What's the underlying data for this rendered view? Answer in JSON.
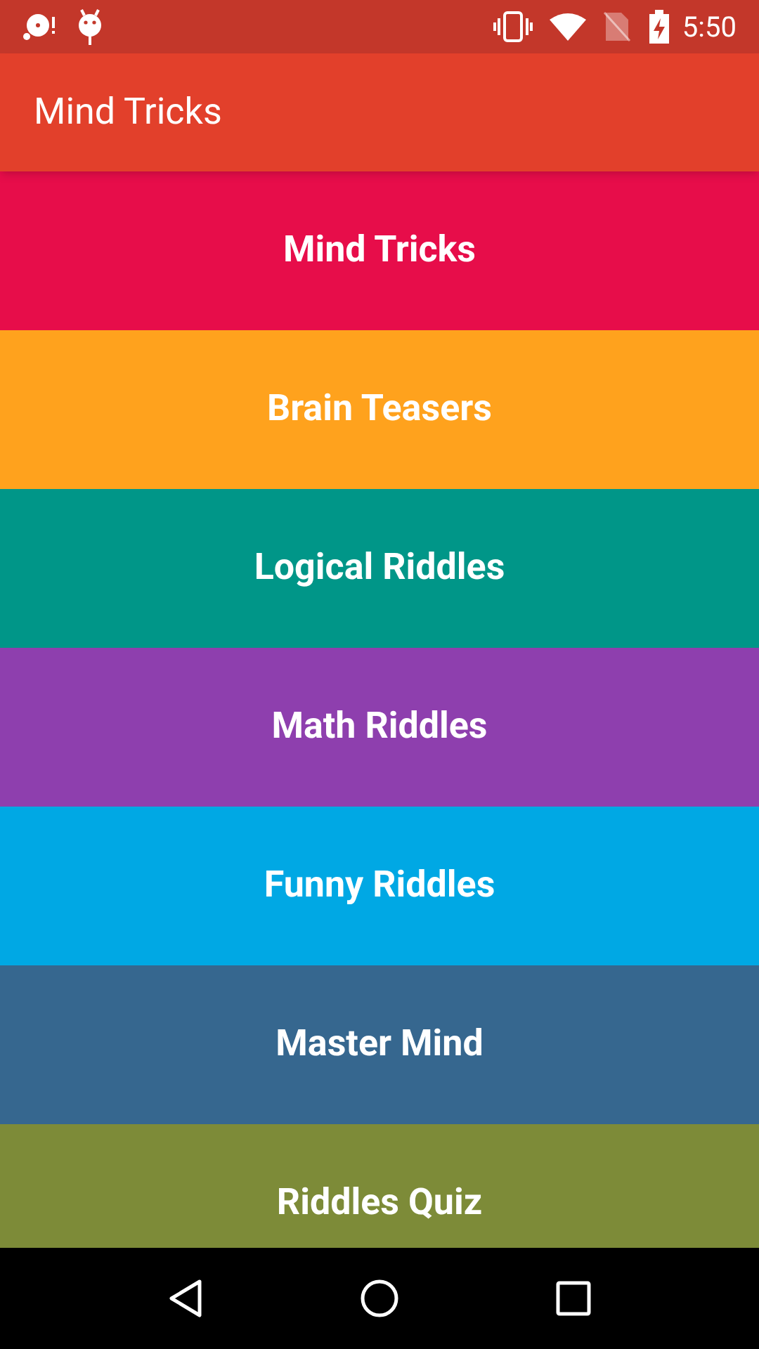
{
  "status_bar": {
    "time": "5:50"
  },
  "app_bar": {
    "title": "Mind Tricks"
  },
  "categories": [
    {
      "label": "Mind Tricks",
      "color": "#e70d4a"
    },
    {
      "label": "Brain Teasers",
      "color": "#ffa21d"
    },
    {
      "label": "Logical Riddles",
      "color": "#009688"
    },
    {
      "label": "Math Riddles",
      "color": "#8e3fae"
    },
    {
      "label": "Funny Riddles",
      "color": "#00a8e4"
    },
    {
      "label": "Master Mind",
      "color": "#36678f"
    },
    {
      "label": "Riddles Quiz",
      "color": "#7d8b38"
    }
  ]
}
